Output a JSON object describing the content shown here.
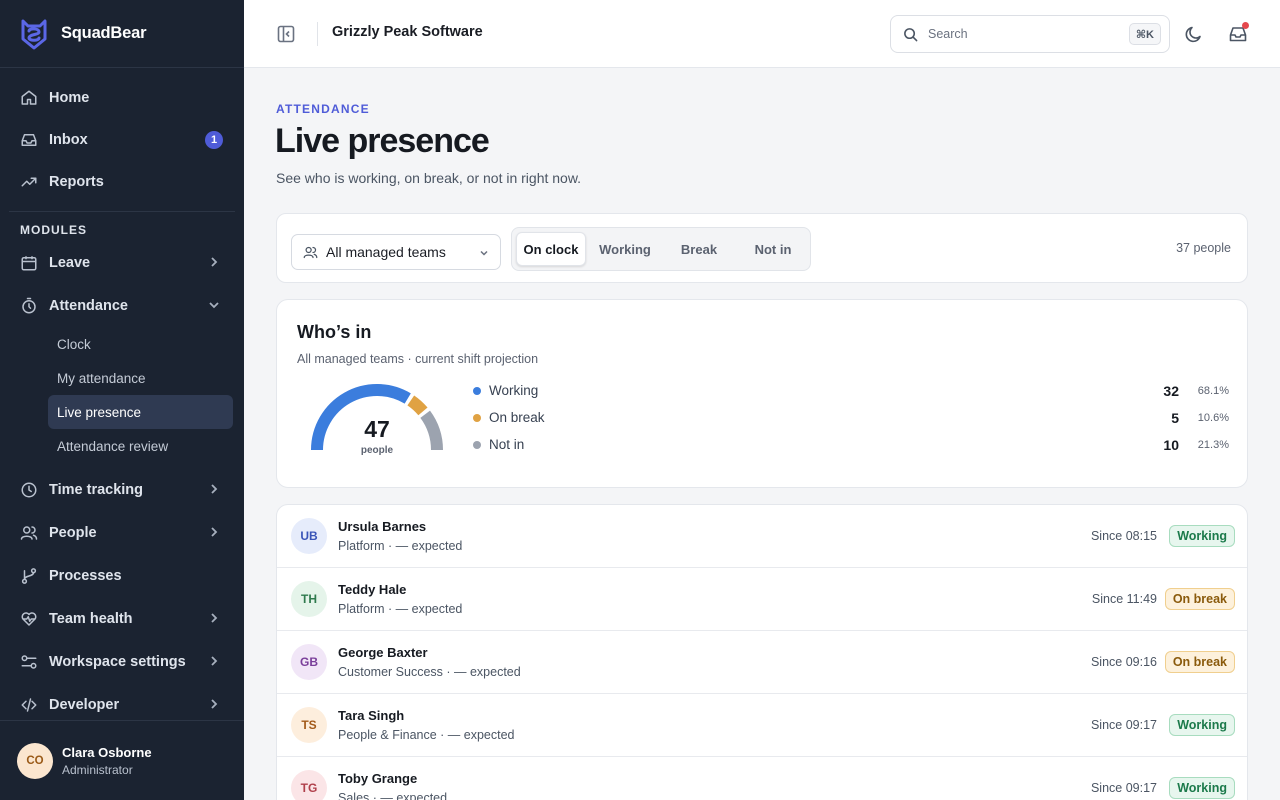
{
  "brand": {
    "name": "SquadBear"
  },
  "sidebar": {
    "top_items": [
      {
        "label": "Home",
        "icon": "home-icon"
      },
      {
        "label": "Inbox",
        "icon": "inbox-icon",
        "badge": "1"
      },
      {
        "label": "Reports",
        "icon": "trending-up-icon"
      }
    ],
    "section_label": "MODULES",
    "modules": [
      {
        "label": "Leave",
        "icon": "calendar-icon"
      },
      {
        "label": "Attendance",
        "icon": "timer-icon",
        "expanded": true
      },
      {
        "label": "Time tracking",
        "icon": "clock-icon"
      },
      {
        "label": "People",
        "icon": "users-icon"
      },
      {
        "label": "Processes",
        "icon": "git-branch-icon"
      },
      {
        "label": "Team health",
        "icon": "heart-pulse-icon"
      },
      {
        "label": "Workspace settings",
        "icon": "sliders-icon"
      },
      {
        "label": "Developer",
        "icon": "code-icon"
      }
    ],
    "attendance_sub": [
      "Clock",
      "My attendance",
      "Live presence",
      "Attendance review"
    ],
    "active_sub": "Live presence",
    "user": {
      "initials": "CO",
      "name": "Clara Osborne",
      "role": "Administrator"
    }
  },
  "topbar": {
    "org": "Grizzly Peak Software",
    "search_placeholder": "Search",
    "shortcut": "⌘K"
  },
  "page": {
    "eyebrow": "ATTENDANCE",
    "title": "Live presence",
    "subtitle": "See who is working, on break, or not in right now."
  },
  "filters": {
    "team_select": "All managed teams",
    "segments": [
      "On clock",
      "Working",
      "Break",
      "Not in"
    ],
    "active_segment": "On clock",
    "count": "37 people"
  },
  "summary": {
    "title": "Who’s in",
    "subtitle": "All managed teams · current shift projection",
    "total": "47",
    "total_label": "people",
    "items": [
      {
        "name": "Working",
        "value": "32",
        "pct": "68.1%",
        "color": "#3b7ddd"
      },
      {
        "name": "On break",
        "value": "5",
        "pct": "10.6%",
        "color": "#e0a243"
      },
      {
        "name": "Not in",
        "value": "10",
        "pct": "21.3%",
        "color": "#9ca3af"
      }
    ]
  },
  "people": [
    {
      "initials": "UB",
      "name": "Ursula Barnes",
      "sub": "Platform · — expected",
      "since": "Since 08:15",
      "status": "Working",
      "avatar_bg": "#e6ecfb",
      "avatar_fg": "#3a55b8"
    },
    {
      "initials": "TH",
      "name": "Teddy Hale",
      "sub": "Platform · — expected",
      "since": "Since 11:49",
      "status": "On break",
      "avatar_bg": "#e5f4ea",
      "avatar_fg": "#2f7a4d"
    },
    {
      "initials": "GB",
      "name": "George Baxter",
      "sub": "Customer Success · — expected",
      "since": "Since 09:16",
      "status": "On break",
      "avatar_bg": "#f1e6f7",
      "avatar_fg": "#7a3f9a"
    },
    {
      "initials": "TS",
      "name": "Tara Singh",
      "sub": "People & Finance · — expected",
      "since": "Since 09:17",
      "status": "Working",
      "avatar_bg": "#fdeedd",
      "avatar_fg": "#a25a1a"
    },
    {
      "initials": "TG",
      "name": "Toby Grange",
      "sub": "Sales · — expected",
      "since": "Since 09:17",
      "status": "Working",
      "avatar_bg": "#fbe5e7",
      "avatar_fg": "#b0404b"
    }
  ]
}
